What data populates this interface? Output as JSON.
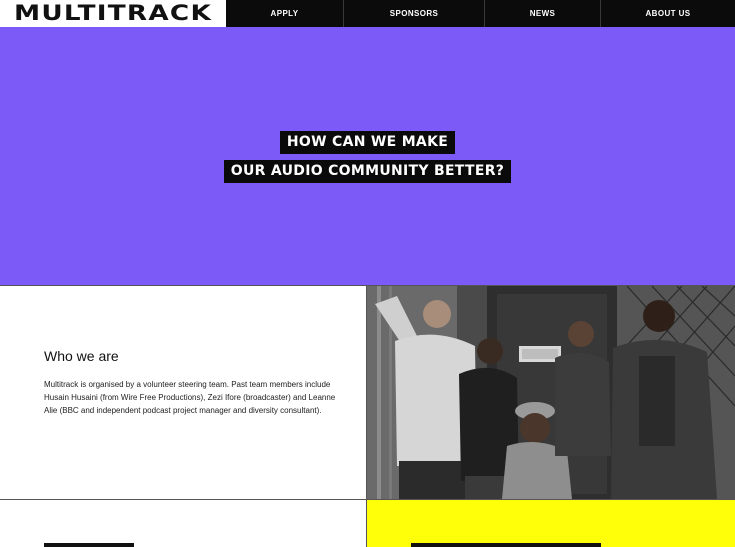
{
  "brand": {
    "logo": "MULTITRACK"
  },
  "nav": {
    "items": [
      {
        "label": "APPLY"
      },
      {
        "label": "SPONSORS"
      },
      {
        "label": "NEWS"
      },
      {
        "label": "ABOUT US"
      }
    ]
  },
  "hero": {
    "line1": "HOW CAN WE MAKE",
    "line2": "OUR AUDIO COMMUNITY BETTER?",
    "background": "#7b5af8"
  },
  "who": {
    "heading": "Who we are",
    "body": "Multitrack is organised by a volunteer steering team. Past team members include Husain Husaini (from Wire Free Productions), Zezi Ifore (broadcaster) and Leanne Alie (BBC and independent podcast project manager and diversity consultant)."
  },
  "colors": {
    "accent_purple": "#7b5af8",
    "accent_yellow": "#ffff0a",
    "nav_bg": "#0b0b0b"
  }
}
